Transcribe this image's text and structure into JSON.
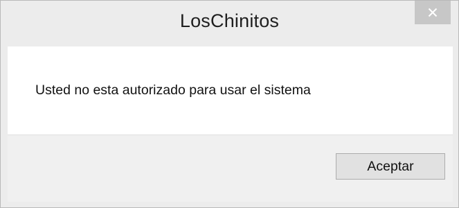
{
  "window": {
    "title": "LosChinitos"
  },
  "dialog": {
    "message": "Usted no esta autorizado para usar el sistema",
    "ok_label": "Aceptar"
  },
  "icons": {
    "close": "close-icon"
  },
  "colors": {
    "frame": "#ececec",
    "content_bg": "#ffffff",
    "close_button": "#c7c7c7"
  }
}
